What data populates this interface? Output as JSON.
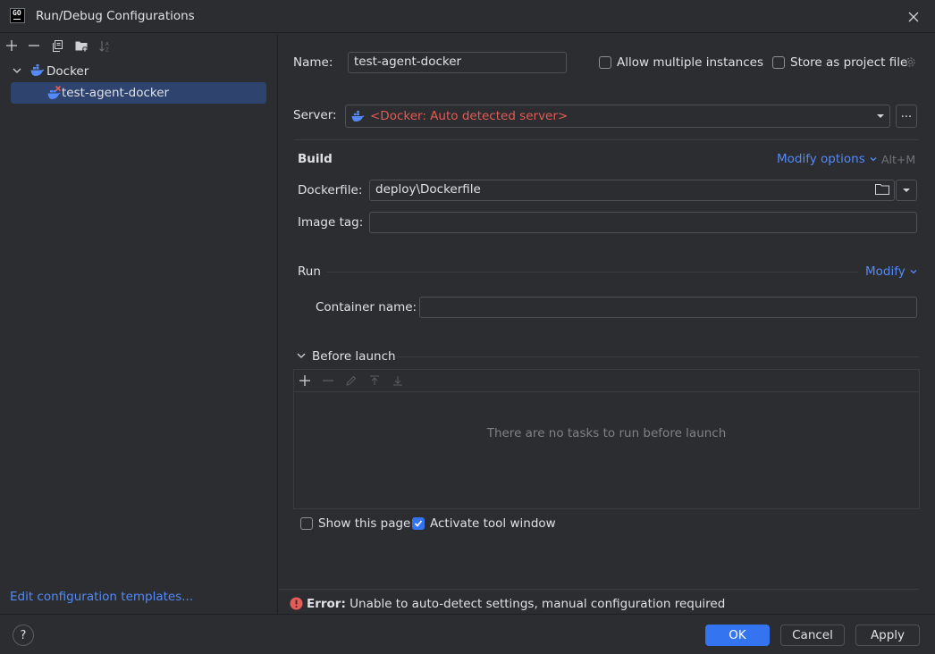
{
  "window": {
    "title": "Run/Debug Configurations",
    "logo_text": "GO"
  },
  "left": {
    "tree": {
      "group_label": "Docker",
      "items": [
        {
          "label": "test-agent-docker",
          "selected": true
        }
      ]
    },
    "edit_templates_link": "Edit configuration templates..."
  },
  "form": {
    "name_label": "Name:",
    "name_value": "test-agent-docker",
    "allow_multiple_label": "Allow multiple instances",
    "allow_multiple_checked": false,
    "store_as_project_label": "Store as project file",
    "store_as_project_checked": false,
    "server_label": "Server:",
    "server_value": "<Docker: Auto detected server>",
    "server_more": "...",
    "build": {
      "title": "Build",
      "modify_options": "Modify options",
      "modify_shortcut": "Alt+M",
      "dockerfile_label": "Dockerfile:",
      "dockerfile_value": "deploy\\Dockerfile",
      "image_tag_label": "Image tag:",
      "image_tag_value": ""
    },
    "run": {
      "title": "Run",
      "modify": "Modify",
      "container_name_label": "Container name:",
      "container_name_value": ""
    },
    "before_launch": {
      "title": "Before launch",
      "empty_text": "There are no tasks to run before launch"
    },
    "show_this_page_label": "Show this page",
    "show_this_page_checked": false,
    "activate_tool_window_label": "Activate tool window",
    "activate_tool_window_checked": true,
    "error": {
      "prefix": "Error:",
      "message": " Unable to auto-detect settings, manual configuration required"
    }
  },
  "buttons": {
    "help": "?",
    "ok": "OK",
    "cancel": "Cancel",
    "apply": "Apply"
  },
  "colors": {
    "accent": "#3574f0",
    "link": "#548af7",
    "error": "#e55b55",
    "selection": "#2e436e",
    "background": "#2b2d30"
  }
}
